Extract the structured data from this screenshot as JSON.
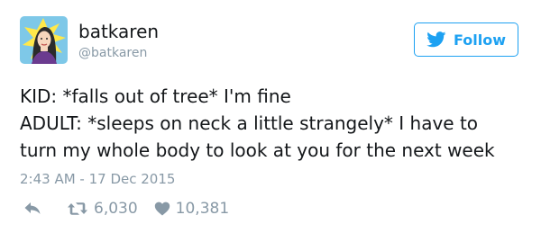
{
  "user": {
    "display_name": "batkaren",
    "handle": "@batkaren",
    "avatar_icon": "avatar-illustration"
  },
  "follow_button": {
    "label": "Follow",
    "icon": "twitter-bird-icon",
    "color": "#1da1f2"
  },
  "tweet": {
    "text": "KID: *falls out of tree* I'm fine\nADULT: *sleeps on neck a little strangely* I have to\nturn my whole body to look at you for the next week",
    "timestamp": "2:43 AM - 17 Dec 2015"
  },
  "actions": {
    "reply_icon": "reply-icon",
    "retweet_icon": "retweet-icon",
    "retweet_count": "6,030",
    "like_icon": "heart-icon",
    "like_count": "10,381"
  },
  "colors": {
    "text": "#14171a",
    "muted": "#8899a6",
    "accent": "#1da1f2"
  }
}
